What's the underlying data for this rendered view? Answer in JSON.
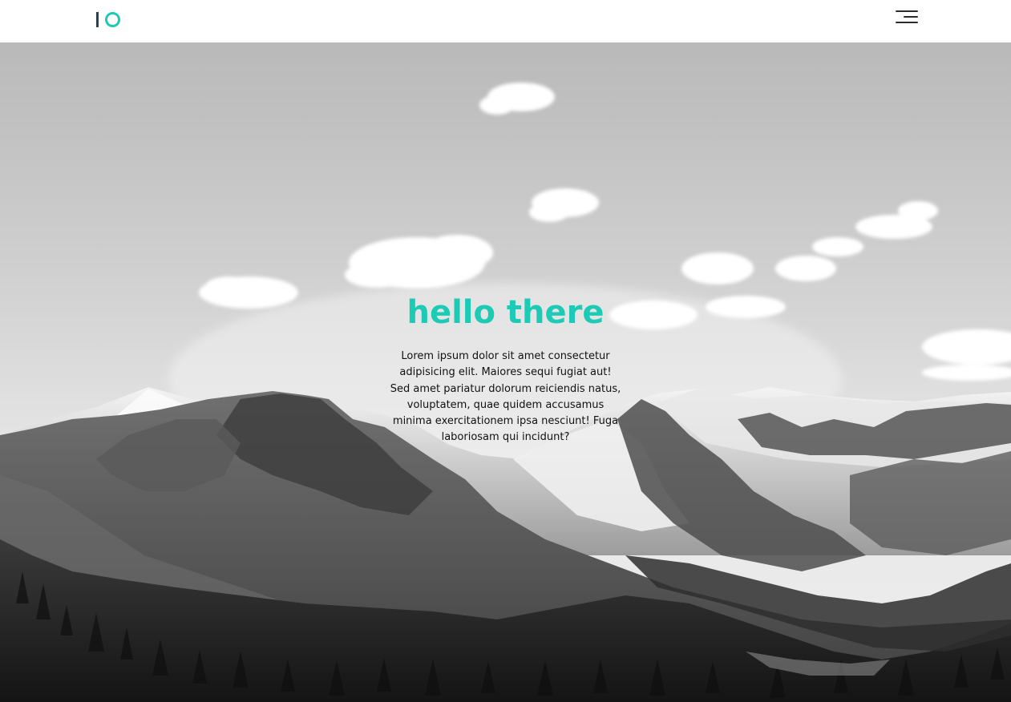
{
  "header": {
    "logo_name": "logo-mark",
    "menu_icon": "hamburger-menu-icon"
  },
  "hero": {
    "background": "mountain-landscape-image",
    "title": "hello there",
    "body": "Lorem ipsum dolor sit amet consectetur adipisicing elit. Maiores sequi fugiat aut! Sed amet pariatur dolorum reiciendis natus, voluptatem, quae quidem accusamus minima exercitationem ipsa nesciunt! Fuga laboriosam qui incidunt?"
  },
  "colors": {
    "accent": "#1ccab5",
    "logo_dark": "#2c3e4f",
    "header_bg": "#ffffff"
  }
}
